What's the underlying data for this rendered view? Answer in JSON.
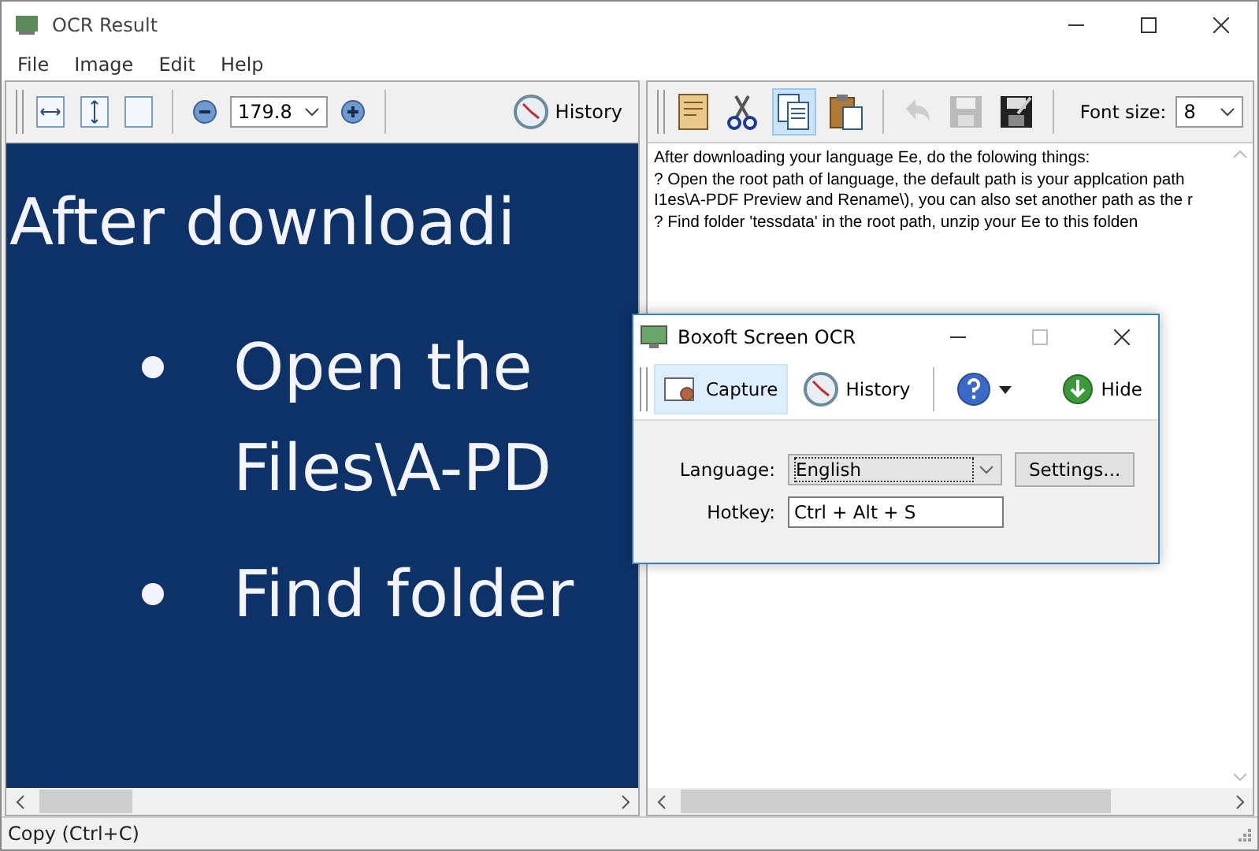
{
  "window": {
    "title": "OCR Result"
  },
  "menu": [
    "File",
    "Image",
    "Edit",
    "Help"
  ],
  "image_toolbar": {
    "zoom": "179.8",
    "history": "History"
  },
  "image_view": {
    "lines": [
      {
        "kind": "heading",
        "text": "After downloadi"
      },
      {
        "kind": "bullet",
        "text": "Open the"
      },
      {
        "kind": "plain",
        "text": "Files\\A-PD"
      },
      {
        "kind": "bullet",
        "text": "Find folder"
      }
    ]
  },
  "text_toolbar": {
    "font_size_label": "Font size:",
    "font_size": "8"
  },
  "text_view": {
    "lines": [
      "After downloading your language Ee, do the folowing things:",
      "? Open the root path of language, the default path is your applcation path",
      "I1es\\A-PDF Preview and Rename\\), you can also set another path as the r",
      "? Find folder 'tessdata' in the root path, unzip your Ee to this folden"
    ]
  },
  "status_bar": {
    "text": "Copy (Ctrl+C)"
  },
  "dialog": {
    "title": "Boxoft Screen OCR",
    "toolbar": [
      {
        "kind": "capture",
        "label": "Capture",
        "selected": true
      },
      {
        "kind": "history",
        "label": "History",
        "selected": false
      },
      {
        "kind": "help",
        "selected": false
      },
      {
        "kind": "hide",
        "label": "Hide",
        "selected": false
      }
    ],
    "language_label": "Language:",
    "language": "English",
    "settings": "Settings...",
    "hotkey_label": "Hotkey:",
    "hotkey": "Ctrl + Alt + S"
  }
}
